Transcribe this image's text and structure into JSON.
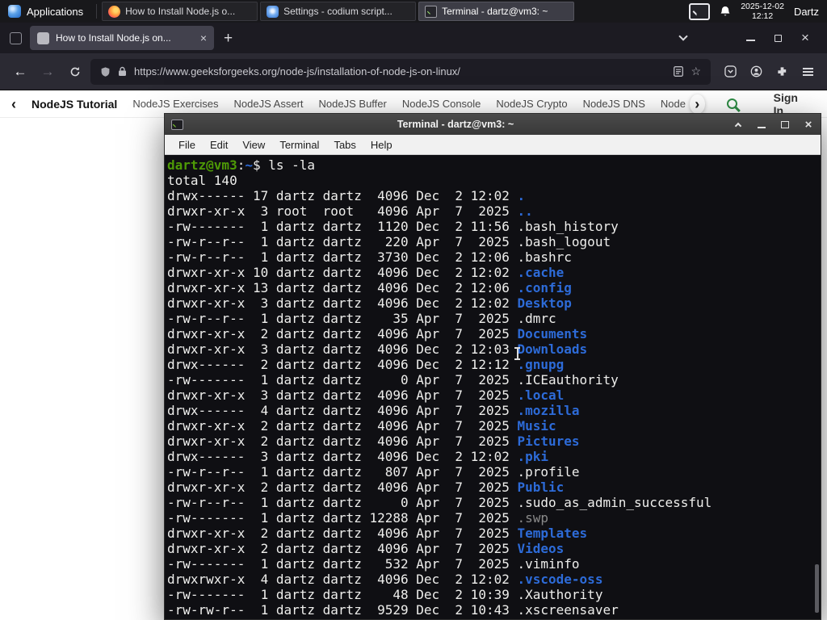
{
  "panel": {
    "applications_label": "Applications",
    "tasks": [
      {
        "label": "How to Install Node.js o...",
        "icon": "firefox-icon"
      },
      {
        "label": "Settings - codium script...",
        "icon": "settings-icon"
      },
      {
        "label": "Terminal - dartz@vm3: ~",
        "icon": "terminal-icon"
      }
    ],
    "clock": {
      "date": "2025-12-02",
      "time": "12:12"
    },
    "user": "Dartz"
  },
  "browser": {
    "tab": {
      "title": "How to Install Node.js on..."
    },
    "toolbar": {
      "url": "https://www.geeksforgeeks.org/node-js/installation-of-node-js-on-linux/"
    },
    "site_nav": {
      "items": [
        "NodeJS Tutorial",
        "NodeJS Exercises",
        "NodeJS Assert",
        "NodeJS Buffer",
        "NodeJS Console",
        "NodeJS Crypto",
        "NodeJS DNS",
        "Node"
      ],
      "sign_in": "Sign In"
    }
  },
  "icons": {
    "tab_close": "×",
    "new_tab": "+",
    "back": "←",
    "forward": "→",
    "star": "☆",
    "window_close": "×",
    "nav_prev": "‹",
    "nav_next": "›"
  },
  "terminal": {
    "title": "Terminal - dartz@vm3: ~",
    "menu": [
      "File",
      "Edit",
      "View",
      "Terminal",
      "Tabs",
      "Help"
    ],
    "prompt": {
      "user_host": "dartz@vm3",
      "colon": ":",
      "path": "~",
      "symbol": "$",
      "command": "ls -la"
    },
    "lines": [
      {
        "kind": "prompt"
      },
      {
        "kind": "plain",
        "text": "total 140"
      },
      {
        "kind": "ls",
        "text": "drwx------ 17 dartz dartz  4096 Dec  2 12:02 ",
        "name": ".",
        "type": "dir"
      },
      {
        "kind": "ls",
        "text": "drwxr-xr-x  3 root  root   4096 Apr  7  2025 ",
        "name": "..",
        "type": "dir"
      },
      {
        "kind": "ls",
        "text": "-rw-------  1 dartz dartz  1120 Dec  2 11:56 ",
        "name": ".bash_history",
        "type": "file"
      },
      {
        "kind": "ls",
        "text": "-rw-r--r--  1 dartz dartz   220 Apr  7  2025 ",
        "name": ".bash_logout",
        "type": "file"
      },
      {
        "kind": "ls",
        "text": "-rw-r--r--  1 dartz dartz  3730 Dec  2 12:06 ",
        "name": ".bashrc",
        "type": "file"
      },
      {
        "kind": "ls",
        "text": "drwxr-xr-x 10 dartz dartz  4096 Dec  2 12:02 ",
        "name": ".cache",
        "type": "dir"
      },
      {
        "kind": "ls",
        "text": "drwxr-xr-x 13 dartz dartz  4096 Dec  2 12:06 ",
        "name": ".config",
        "type": "dir"
      },
      {
        "kind": "ls",
        "text": "drwxr-xr-x  3 dartz dartz  4096 Dec  2 12:02 ",
        "name": "Desktop",
        "type": "dir"
      },
      {
        "kind": "ls",
        "text": "-rw-r--r--  1 dartz dartz    35 Apr  7  2025 ",
        "name": ".dmrc",
        "type": "file"
      },
      {
        "kind": "ls",
        "text": "drwxr-xr-x  2 dartz dartz  4096 Apr  7  2025 ",
        "name": "Documents",
        "type": "dir"
      },
      {
        "kind": "ls",
        "text": "drwxr-xr-x  3 dartz dartz  4096 Dec  2 12:03 ",
        "name": "Downloads",
        "type": "dir"
      },
      {
        "kind": "ls",
        "text": "drwx------  2 dartz dartz  4096 Dec  2 12:12 ",
        "name": ".gnupg",
        "type": "dir"
      },
      {
        "kind": "ls",
        "text": "-rw-------  1 dartz dartz     0 Apr  7  2025 ",
        "name": ".ICEauthority",
        "type": "file"
      },
      {
        "kind": "ls",
        "text": "drwxr-xr-x  3 dartz dartz  4096 Apr  7  2025 ",
        "name": ".local",
        "type": "dir"
      },
      {
        "kind": "ls",
        "text": "drwx------  4 dartz dartz  4096 Apr  7  2025 ",
        "name": ".mozilla",
        "type": "dir"
      },
      {
        "kind": "ls",
        "text": "drwxr-xr-x  2 dartz dartz  4096 Apr  7  2025 ",
        "name": "Music",
        "type": "dir"
      },
      {
        "kind": "ls",
        "text": "drwxr-xr-x  2 dartz dartz  4096 Apr  7  2025 ",
        "name": "Pictures",
        "type": "dir"
      },
      {
        "kind": "ls",
        "text": "drwx------  3 dartz dartz  4096 Dec  2 12:02 ",
        "name": ".pki",
        "type": "dir"
      },
      {
        "kind": "ls",
        "text": "-rw-r--r--  1 dartz dartz   807 Apr  7  2025 ",
        "name": ".profile",
        "type": "file"
      },
      {
        "kind": "ls",
        "text": "drwxr-xr-x  2 dartz dartz  4096 Apr  7  2025 ",
        "name": "Public",
        "type": "dir"
      },
      {
        "kind": "ls",
        "text": "-rw-r--r--  1 dartz dartz     0 Apr  7  2025 ",
        "name": ".sudo_as_admin_successful",
        "type": "file"
      },
      {
        "kind": "ls",
        "text": "-rw-------  1 dartz dartz 12288 Apr  7  2025 ",
        "name": ".swp",
        "type": "dim"
      },
      {
        "kind": "ls",
        "text": "drwxr-xr-x  2 dartz dartz  4096 Apr  7  2025 ",
        "name": "Templates",
        "type": "dir"
      },
      {
        "kind": "ls",
        "text": "drwxr-xr-x  2 dartz dartz  4096 Apr  7  2025 ",
        "name": "Videos",
        "type": "dir"
      },
      {
        "kind": "ls",
        "text": "-rw-------  1 dartz dartz   532 Apr  7  2025 ",
        "name": ".viminfo",
        "type": "file"
      },
      {
        "kind": "ls",
        "text": "drwxrwxr-x  4 dartz dartz  4096 Dec  2 12:02 ",
        "name": ".vscode-oss",
        "type": "dir"
      },
      {
        "kind": "ls",
        "text": "-rw-------  1 dartz dartz    48 Dec  2 10:39 ",
        "name": ".Xauthority",
        "type": "file"
      },
      {
        "kind": "ls",
        "text": "-rw-rw-r--  1 dartz dartz  9529 Dec  2 10:43 ",
        "name": ".xscreensaver",
        "type": "file"
      }
    ]
  },
  "colors": {
    "gfg_green": "#2f8d46",
    "dir_blue": "#2d6bd8",
    "prompt_green": "#4e9a06",
    "terminal_bg": "#0f0f13",
    "panel_bg": "#18181b"
  }
}
